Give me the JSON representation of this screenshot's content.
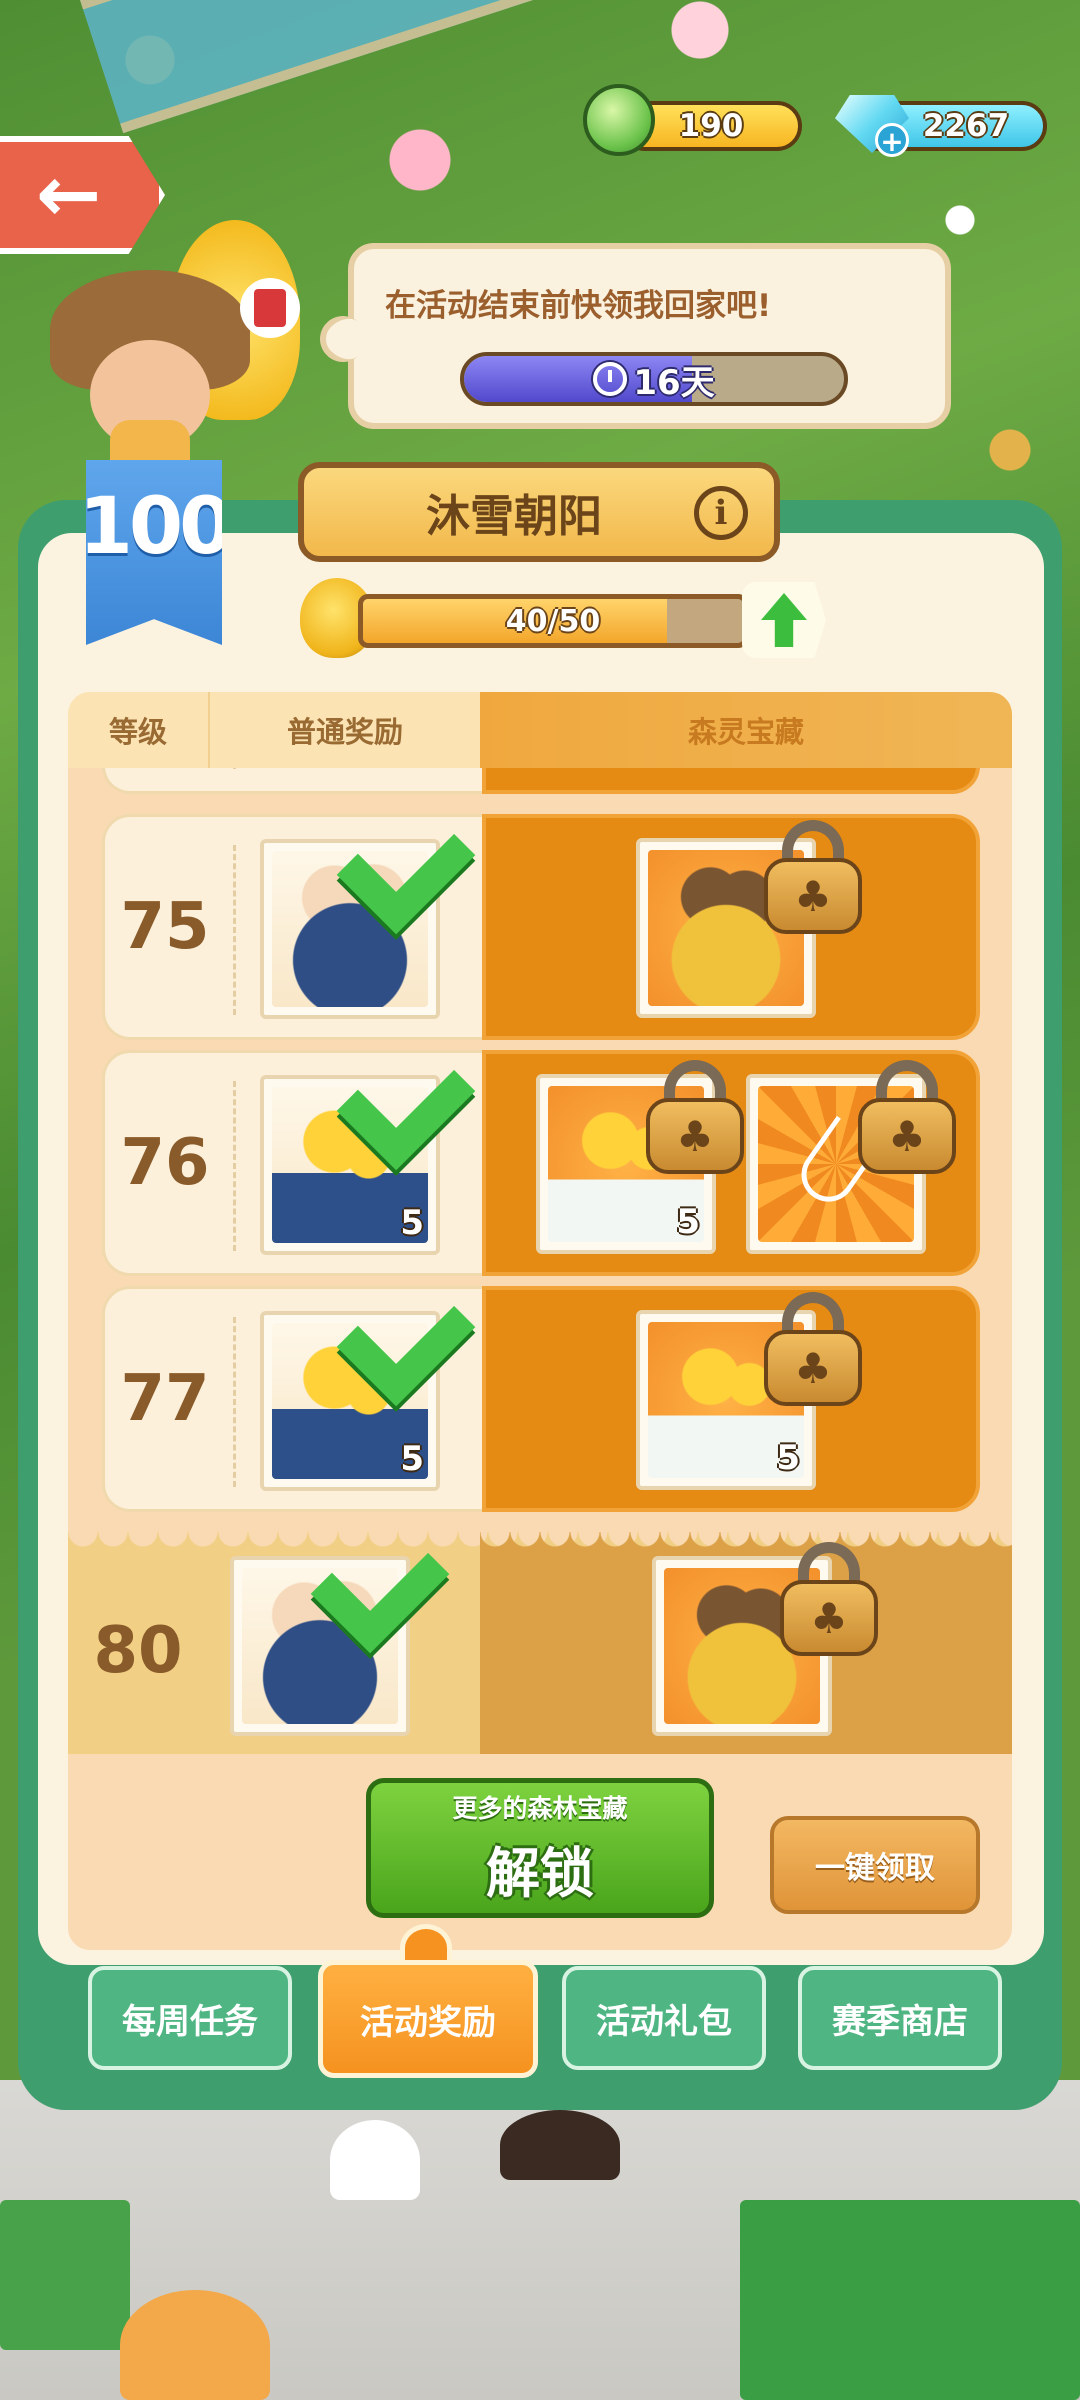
{
  "hud": {
    "coins": "190",
    "gems": "2267"
  },
  "event": {
    "speech": "在活动结束前快领我回家吧!",
    "timer": "16天",
    "timer_progress": 0.6
  },
  "season": {
    "title": "沐雪朝阳",
    "level": "100",
    "xp_text": "40/50",
    "xp_progress": 0.8
  },
  "table": {
    "headers": {
      "level": "等级",
      "normal": "普通奖励",
      "premium": "森灵宝藏"
    },
    "rows": [
      {
        "level": "75",
        "normal": {
          "item": "basket-icon",
          "qty": "",
          "claimed": true
        },
        "premium": [
          {
            "item": "basket-icon",
            "qty": "",
            "locked": true
          }
        ]
      },
      {
        "level": "76",
        "normal": {
          "item": "flower-icon",
          "qty": "5",
          "claimed": true
        },
        "premium": [
          {
            "item": "snow-flower-icon",
            "qty": "5",
            "locked": true
          },
          {
            "item": "broom-icon",
            "qty": "",
            "locked": true
          }
        ]
      },
      {
        "level": "77",
        "normal": {
          "item": "flower-icon",
          "qty": "5",
          "claimed": true
        },
        "premium": [
          {
            "item": "snow-flower-icon",
            "qty": "5",
            "locked": true
          }
        ]
      },
      {
        "level": "80",
        "normal": {
          "item": "basket-icon",
          "qty": "",
          "claimed": true
        },
        "premium": [
          {
            "item": "basket-icon",
            "qty": "",
            "locked": true
          }
        ]
      }
    ]
  },
  "actions": {
    "unlock_sub": "更多的森林宝藏",
    "unlock_main": "解锁",
    "claim_all": "一键领取"
  },
  "tabs": [
    {
      "label": "每周任务",
      "active": false
    },
    {
      "label": "活动奖励",
      "active": true
    },
    {
      "label": "活动礼包",
      "active": false
    },
    {
      "label": "赛季商店",
      "active": false
    }
  ],
  "colors": {
    "panel_green": "#3f9e6e",
    "premium_orange": "#e58a12",
    "check_green": "#45c64a",
    "unlock_green": "#4aa51c"
  }
}
